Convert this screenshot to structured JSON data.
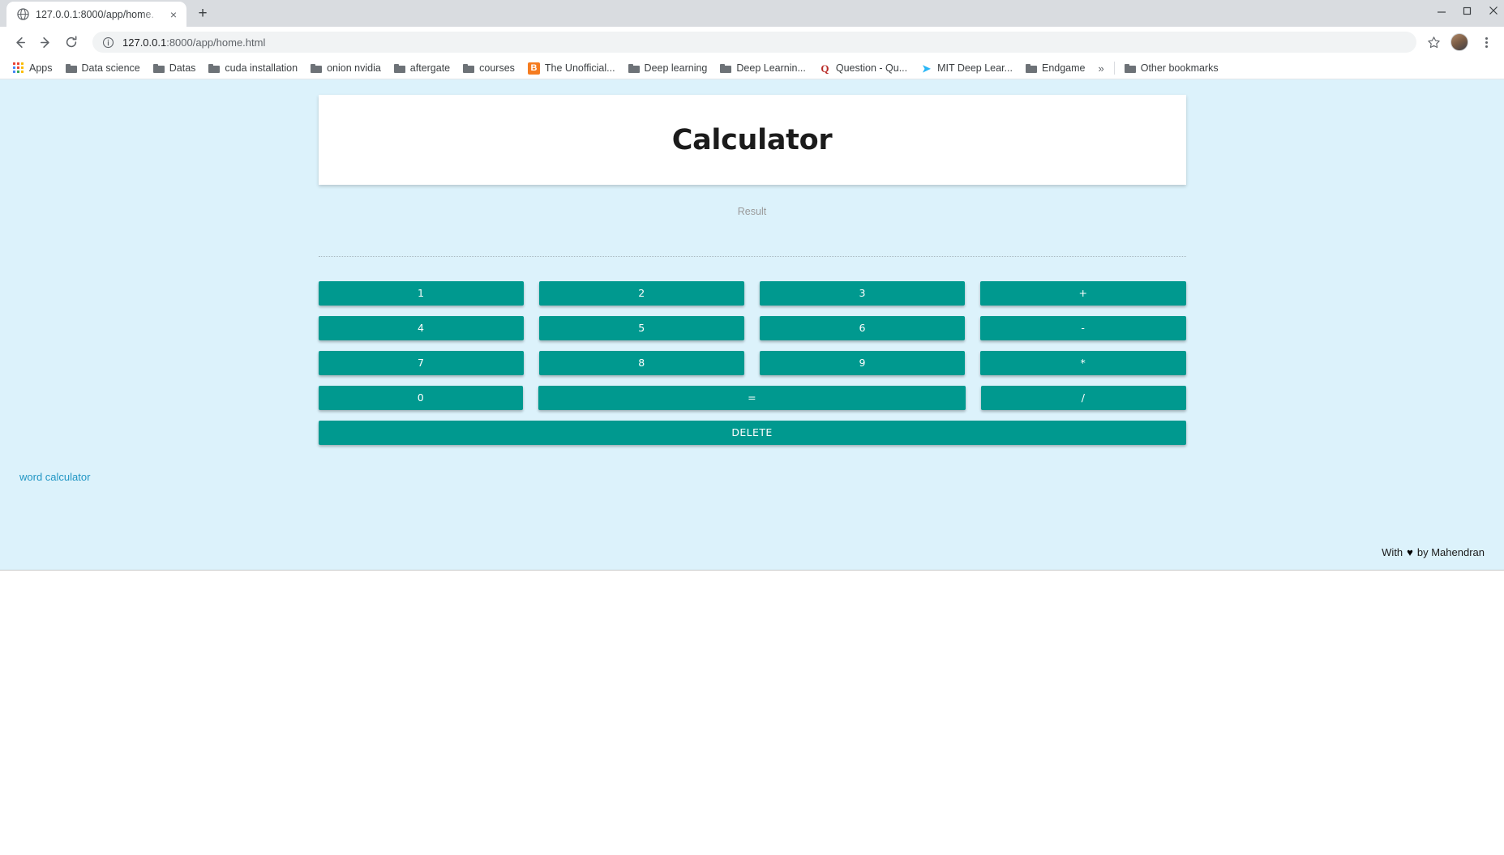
{
  "browser": {
    "tab": {
      "title": "127.0.0.1:8000/app/home.",
      "favicon": "globe-icon",
      "close": "×",
      "newtab": "+"
    },
    "window_controls": {
      "minimize": "—",
      "maximize": "❐",
      "close": "✕"
    },
    "nav": {
      "back": "←",
      "forward": "→",
      "reload": "↻"
    },
    "omnibox": {
      "info_icon": "info-circle-icon",
      "url_host": "127.0.0.1",
      "url_rest": ":8000/app/home.html",
      "star": "☆"
    },
    "bookmarks": {
      "apps_label": "Apps",
      "items": [
        {
          "label": "Data science",
          "icon": "folder"
        },
        {
          "label": "Datas",
          "icon": "folder"
        },
        {
          "label": "cuda installation",
          "icon": "folder"
        },
        {
          "label": "onion nvidia",
          "icon": "folder"
        },
        {
          "label": "aftergate",
          "icon": "folder"
        },
        {
          "label": "courses",
          "icon": "folder"
        },
        {
          "label": "The Unofficial...",
          "icon": "blogger",
          "glyph": "B",
          "color": "#f57c20"
        },
        {
          "label": "Deep learning",
          "icon": "folder"
        },
        {
          "label": "Deep Learnin...",
          "icon": "folder"
        },
        {
          "label": "Question - Qu...",
          "icon": "quora",
          "glyph": "Q",
          "color": "#b92b27",
          "flat": true
        },
        {
          "label": "MIT Deep Lear...",
          "icon": "mit-deeplearning",
          "glyph": "➤",
          "color": "#29b6f6",
          "flat": true
        },
        {
          "label": "Endgame",
          "icon": "folder"
        }
      ],
      "overflow": "»",
      "other_bookmarks": "Other bookmarks"
    }
  },
  "page": {
    "title": "Calculator",
    "result_placeholder": "Result",
    "keypad": {
      "rows": [
        [
          "1",
          "2",
          "3",
          "+"
        ],
        [
          "4",
          "5",
          "6",
          "-"
        ],
        [
          "7",
          "8",
          "9",
          "*"
        ],
        [
          "0",
          "=",
          "/"
        ]
      ],
      "delete_label": "DELETE"
    },
    "word_calculator_link": "word calculator",
    "footer": {
      "prefix": "With",
      "heart": "♥",
      "suffix": "by Mahendran"
    },
    "colors": {
      "page_background": "#dcf2fb",
      "button": "#00998f",
      "button_text": "#ffffff",
      "link": "#2196c4",
      "result_text": "#9a9a9a"
    }
  }
}
